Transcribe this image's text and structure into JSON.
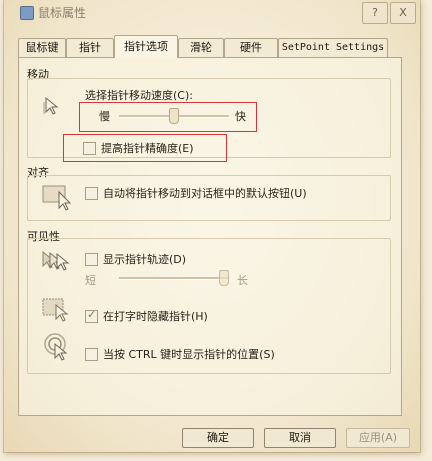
{
  "window": {
    "title": "鼠标属性",
    "help_label": "?",
    "close_label": "X"
  },
  "tabs": [
    {
      "label": "鼠标键",
      "active": false
    },
    {
      "label": "指针",
      "active": false
    },
    {
      "label": "指针选项",
      "active": true
    },
    {
      "label": "滑轮",
      "active": false
    },
    {
      "label": "硬件",
      "active": false
    },
    {
      "label": "SetPoint Settings",
      "active": false
    }
  ],
  "motion": {
    "title": "移动",
    "speed_label": "选择指针移动速度(C):",
    "slow_label": "慢",
    "fast_label": "快",
    "speed_level": 0.5,
    "precision_label": "提高指针精确度(E)",
    "precision_checked": false
  },
  "snap": {
    "title": "对齐",
    "snap_label": "自动将指针移动到对话框中的默认按钮(U)",
    "snap_checked": false
  },
  "visibility": {
    "title": "可见性",
    "trails_label": "显示指针轨迹(D)",
    "trails_checked": false,
    "short_label": "短",
    "long_label": "长",
    "trails_level": 1.0,
    "hide_label": "在打字时隐藏指针(H)",
    "hide_checked": true,
    "ctrl_label": "当按 CTRL 键时显示指针的位置(S)",
    "ctrl_checked": false
  },
  "buttons": {
    "ok": "确定",
    "cancel": "取消",
    "apply": "应用(A)"
  },
  "colors": {
    "highlight": "#d6363a",
    "background": "#f4ecd8"
  }
}
